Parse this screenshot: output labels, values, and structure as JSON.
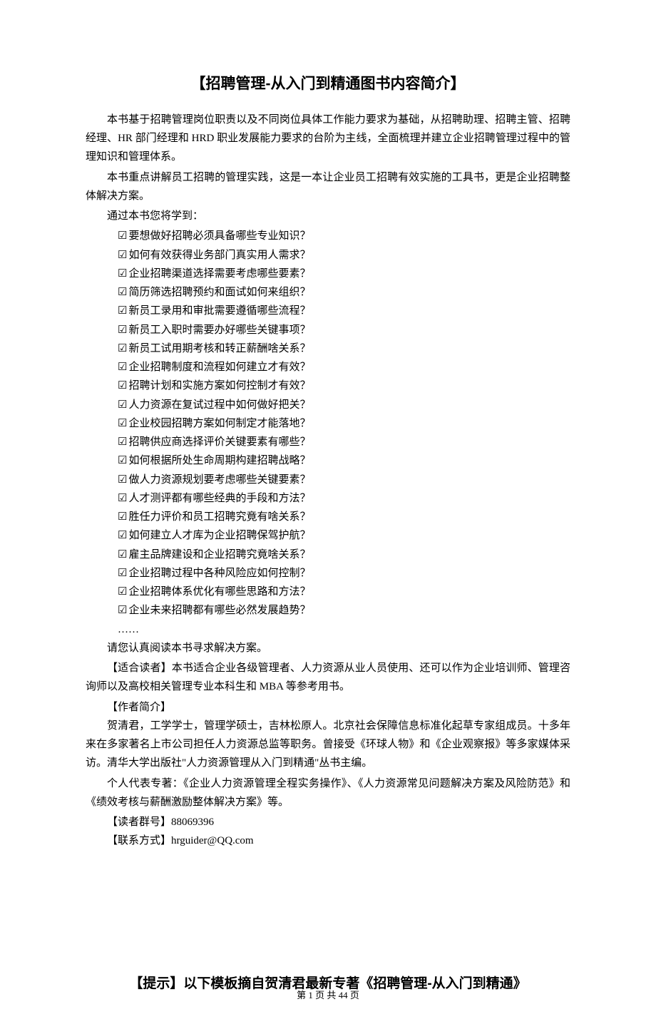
{
  "title": "【招聘管理-从入门到精通图书内容简介】",
  "intro": {
    "p1": "本书基于招聘管理岗位职责以及不同岗位具体工作能力要求为基础，从招聘助理、招聘主管、招聘经理、HR 部门经理和 HRD 职业发展能力要求的台阶为主线，全面梳理并建立企业招聘管理过程中的管理知识和管理体系。",
    "p2": "本书重点讲解员工招聘的管理实践，这是一本让企业员工招聘有效实施的工具书，更是企业招聘整体解决方案。",
    "learn_intro": "通过本书您将学到："
  },
  "checklist": [
    "要想做好招聘必须具备哪些专业知识？",
    "如何有效获得业务部门真实用人需求？",
    "企业招聘渠道选择需要考虑哪些要素？",
    "简历筛选招聘预约和面试如何来组织？",
    "新员工录用和审批需要遵循哪些流程？",
    "新员工入职时需要办好哪些关键事项？",
    "新员工试用期考核和转正薪酬啥关系？",
    "企业招聘制度和流程如何建立才有效？",
    "招聘计划和实施方案如何控制才有效？",
    "人力资源在复试过程中如何做好把关？",
    "企业校园招聘方案如何制定才能落地？",
    "招聘供应商选择评价关键要素有哪些？",
    "如何根据所处生命周期构建招聘战略？",
    "做人力资源规划要考虑哪些关键要素？",
    "人才测评都有哪些经典的手段和方法？",
    "胜任力评价和员工招聘究竟有啥关系？",
    "如何建立人才库为企业招聘保驾护航？",
    "雇主品牌建设和企业招聘究竟啥关系？",
    "企业招聘过程中各种风险应如何控制？",
    "企业招聘体系优化有哪些思路和方法？",
    "企业未来招聘都有哪些必然发展趋势？"
  ],
  "ellipsis": "……",
  "closing_read": "请您认真阅读本书寻求解决方案。",
  "suitable_readers": "【适合读者】本书适合企业各级管理者、人力资源从业人员使用、还可以作为企业培训师、管理咨询师以及高校相关管理专业本科生和 MBA 等参考用书。",
  "author_label": "【作者简介】",
  "author_p1": "贺清君，工学学士，管理学硕士，吉林松原人。北京社会保障信息标准化起草专家组成员。十多年来在多家著名上市公司担任人力资源总监等职务。曾接受《环球人物》和《企业观察报》等多家媒体采访。清华大学出版社\"人力资源管理从入门到精通\"丛书主编。",
  "author_p2": "个人代表专著：《企业人力资源管理全程实务操作》、《人力资源常见问题解决方案及风险防范》和《绩效考核与薪酬激励整体解决方案》等。",
  "reader_group": "【读者群号】88069396",
  "contact": "【联系方式】hrguider@QQ.com",
  "tip": "【提示】以下模板摘自贺清君最新专著《招聘管理-从入门到精通》",
  "footer": "第 1 页 共 44 页"
}
